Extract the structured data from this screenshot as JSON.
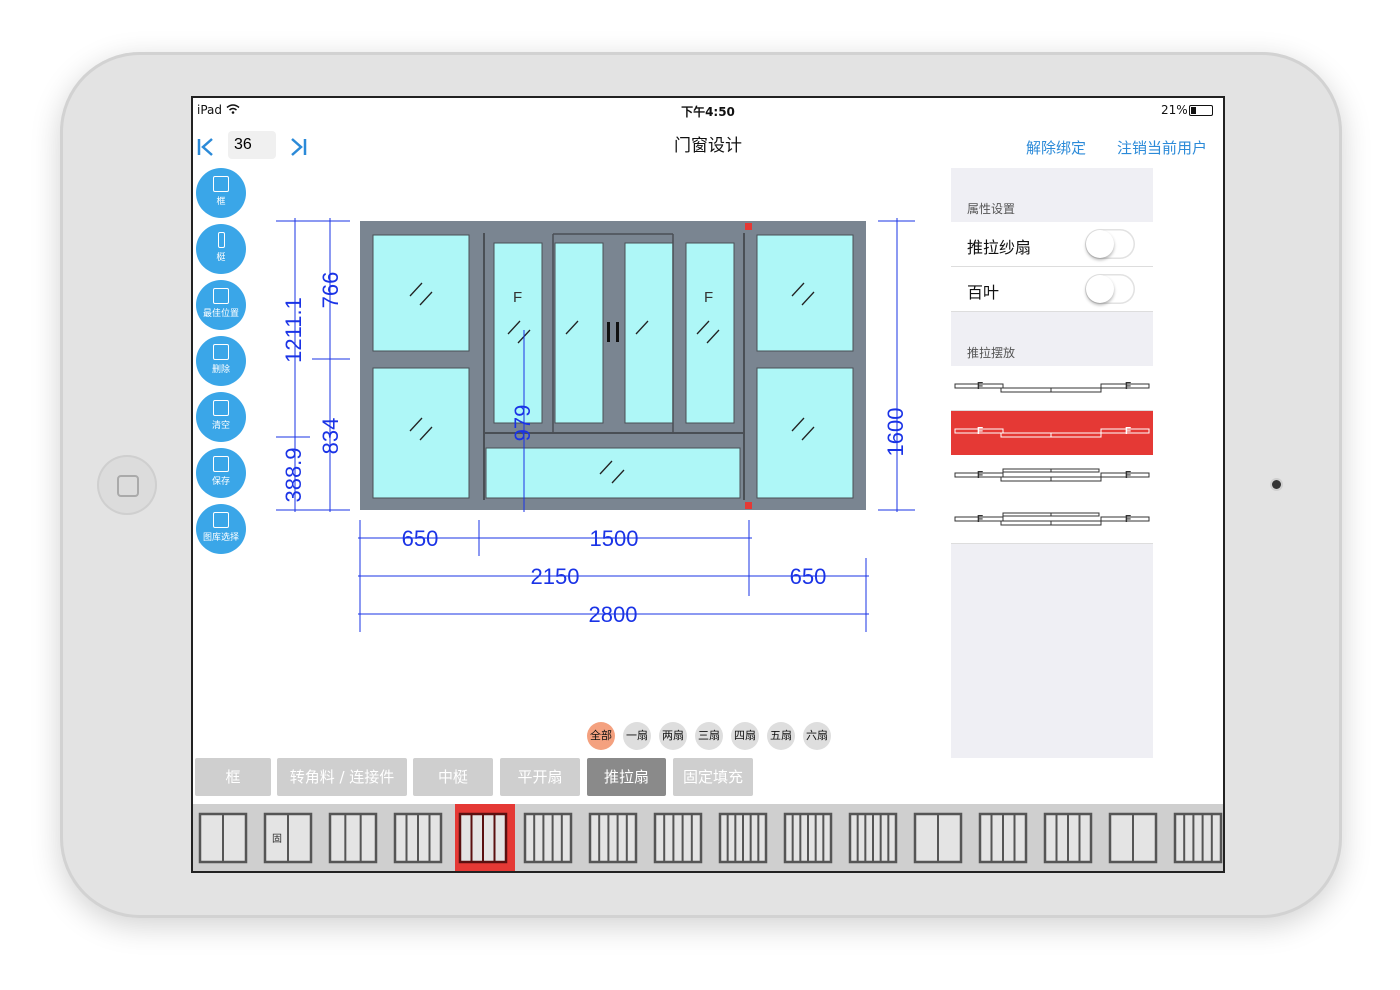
{
  "status": {
    "device": "iPad",
    "time": "下午4:50",
    "battery": "21%"
  },
  "nav": {
    "title": "门窗设计",
    "unbind": "解除绑定",
    "logout": "注销当前用户"
  },
  "pager": {
    "value": "36",
    "first_glyph": "|<",
    "last_glyph": ">|"
  },
  "tools": [
    {
      "label": "框",
      "icon": "frame-icon"
    },
    {
      "label": "梃",
      "icon": "mullion-icon"
    },
    {
      "label": "最佳位置",
      "icon": "best-position-icon"
    },
    {
      "label": "删除",
      "icon": "delete-icon"
    },
    {
      "label": "清空",
      "icon": "trash-icon"
    },
    {
      "label": "保存",
      "icon": "save-icon"
    },
    {
      "label": "图库选择",
      "icon": "gallery-icon"
    }
  ],
  "drawing": {
    "dims": {
      "left_total": "1211.1",
      "left_lower": "388.9",
      "mid_upper": "766",
      "mid_lower": "834",
      "sash_h": "979",
      "right_total": "1600",
      "w_left": "650",
      "w_center": "1500",
      "w_left_center": "2150",
      "w_right": "650",
      "w_total": "2800"
    },
    "fixed_mark": "F",
    "colors": {
      "glass": "#aef7f7",
      "frame": "#7a8591",
      "dim": "#1a33e6"
    }
  },
  "props": {
    "section1": "属性设置",
    "screen_label": "推拉纱扇",
    "screen_on": false,
    "blind_label": "百叶",
    "blind_on": false,
    "section2": "推拉摆放",
    "fixed_mark": "F",
    "layout_selected": 2
  },
  "chips": [
    {
      "label": "全部",
      "active": true
    },
    {
      "label": "一扇"
    },
    {
      "label": "两扇"
    },
    {
      "label": "三扇"
    },
    {
      "label": "四扇"
    },
    {
      "label": "五扇"
    },
    {
      "label": "六扇"
    }
  ],
  "categories": [
    {
      "label": "框"
    },
    {
      "label": "转角料 / 连接件"
    },
    {
      "label": "中梃"
    },
    {
      "label": "平开扇"
    },
    {
      "label": "推拉扇",
      "active": true
    },
    {
      "label": "固定填充"
    }
  ],
  "thumbs": {
    "selected": 5,
    "items": [
      {
        "label": ""
      },
      {
        "label": "固"
      },
      {
        "label": ""
      },
      {
        "label": ""
      },
      {
        "label": ""
      },
      {
        "label": ""
      },
      {
        "label": ""
      },
      {
        "label": ""
      },
      {
        "label": ""
      },
      {
        "label": ""
      },
      {
        "label": ""
      },
      {
        "label": ""
      },
      {
        "label": ""
      },
      {
        "label": ""
      },
      {
        "label": ""
      },
      {
        "label": ""
      }
    ]
  }
}
